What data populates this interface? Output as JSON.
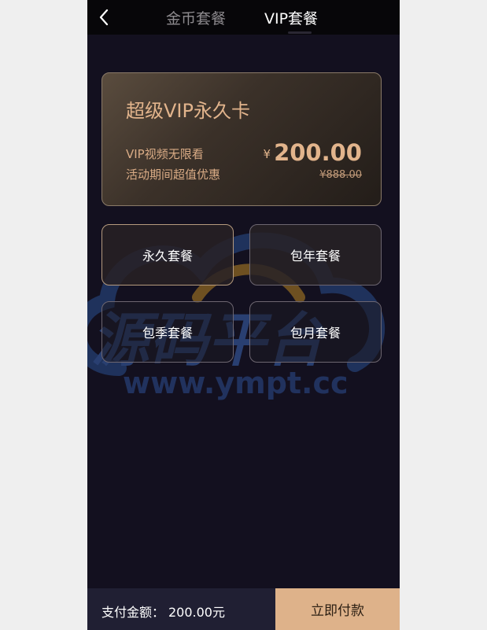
{
  "header": {
    "tabs": [
      {
        "label": "金币套餐",
        "active": false
      },
      {
        "label": "VIP套餐",
        "active": true
      }
    ]
  },
  "featured_card": {
    "title": "超级VIP永久卡",
    "line1": "VIP视频无限看",
    "line2": "活动期间超值优惠",
    "currency": "¥",
    "price": "200.00",
    "original_price": "¥888.00"
  },
  "packages": [
    {
      "label": "永久套餐",
      "selected": true
    },
    {
      "label": "包年套餐",
      "selected": false
    },
    {
      "label": "包季套餐",
      "selected": false
    },
    {
      "label": "包月套餐",
      "selected": false
    }
  ],
  "watermark": {
    "text_cn": "源码平台",
    "text_url": "www.ympt.cc"
  },
  "footer": {
    "total_label": "支付金额：",
    "total_value": "200.00元",
    "pay_label": "立即付款"
  },
  "colors": {
    "accent": "#e2b48c",
    "pay_button": "#deb28a",
    "background": "#13101f"
  }
}
